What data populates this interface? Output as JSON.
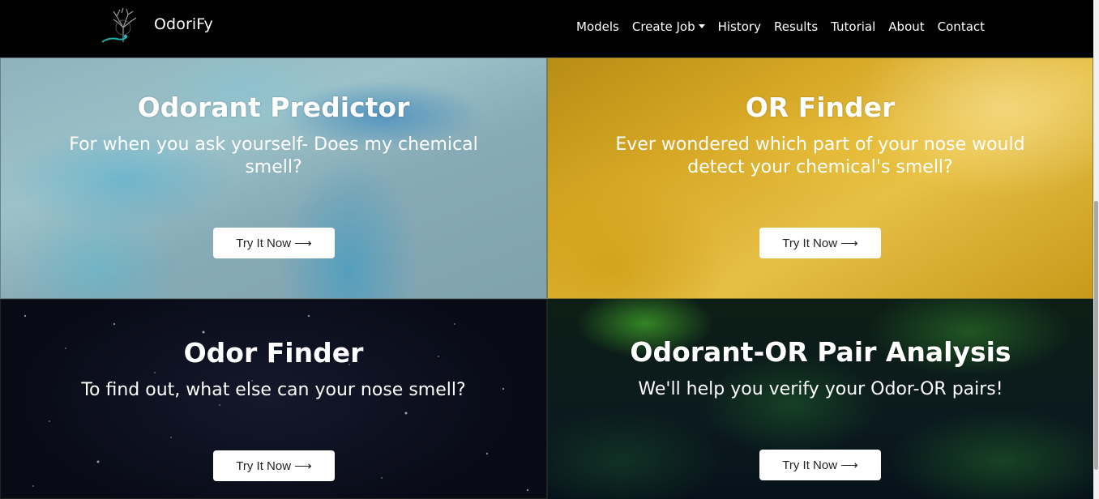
{
  "navbar": {
    "brand": "OdoriFy",
    "logo_icon": "nose-tree-logo-icon",
    "links": [
      {
        "label": "Models"
      },
      {
        "label": "Create Job",
        "dropdown": true
      },
      {
        "label": "History"
      },
      {
        "label": "Results"
      },
      {
        "label": "Tutorial"
      },
      {
        "label": "About"
      },
      {
        "label": "Contact"
      }
    ]
  },
  "cards": [
    {
      "title": "Odorant Predictor",
      "subtitle": "For when you ask yourself- Does my chemical smell?",
      "button": "Try It Now ⟶",
      "theme": "light-blue-marble"
    },
    {
      "title": "OR Finder",
      "subtitle": "Ever wondered which part of your nose would detect your chemical's smell?",
      "button": "Try It Now ⟶",
      "theme": "golden-yellow"
    },
    {
      "title": "Odor Finder",
      "subtitle": "To find out, what else can your nose smell?",
      "button": "Try It Now ⟶",
      "theme": "starry-night"
    },
    {
      "title": "Odorant-OR Pair Analysis",
      "subtitle": "We'll help you verify your Odor-OR pairs!",
      "button": "Try It Now ⟶",
      "theme": "green-nebula"
    }
  ],
  "colors": {
    "navbar_bg": "#000000",
    "button_bg": "#ffffff",
    "text": "#ffffff"
  }
}
